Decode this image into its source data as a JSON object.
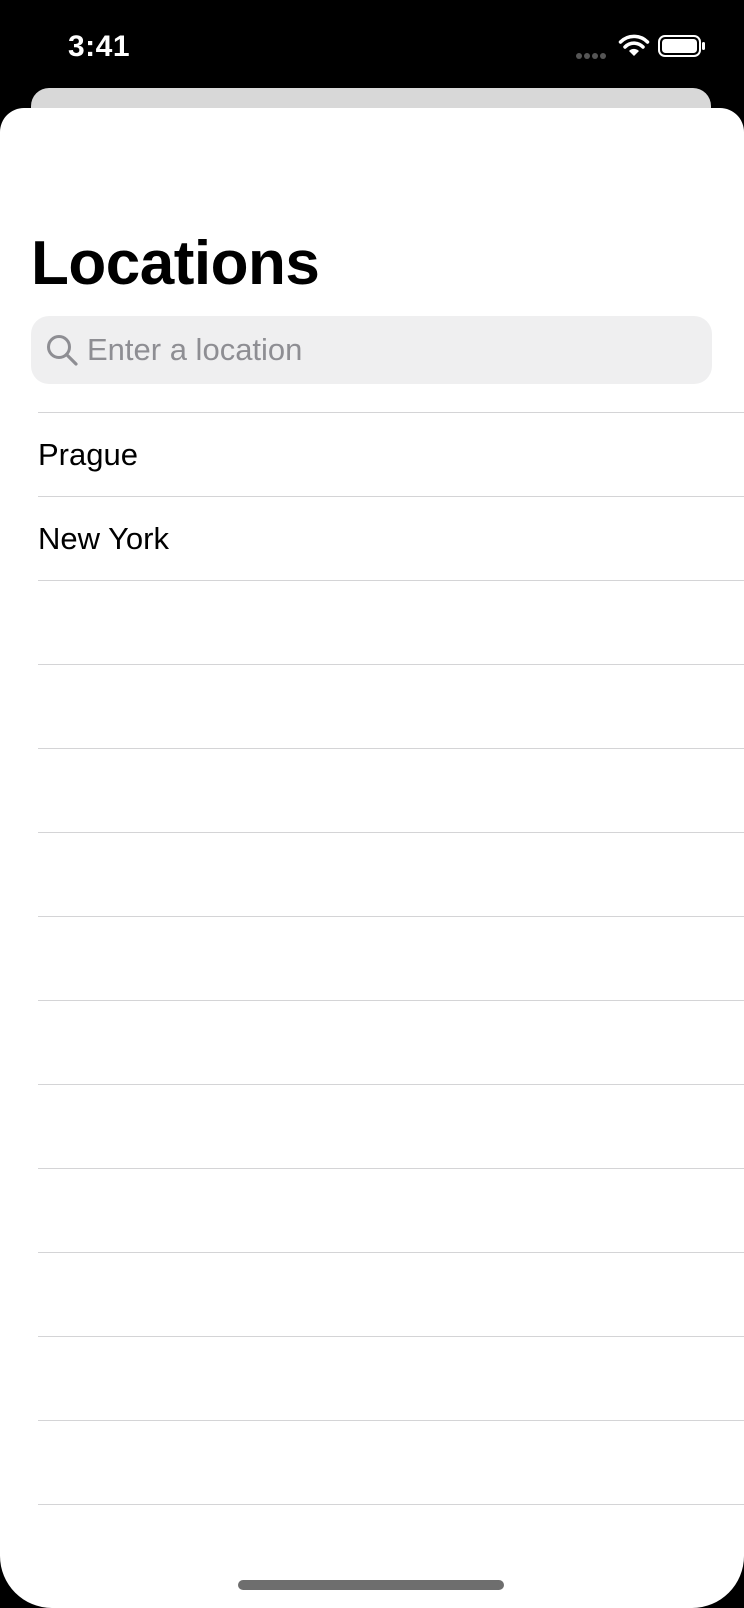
{
  "status_bar": {
    "time": "3:41",
    "icons": [
      "signal-icon",
      "wifi-icon",
      "battery-icon"
    ]
  },
  "header": {
    "title": "Locations"
  },
  "search": {
    "placeholder": "Enter a location",
    "value": "",
    "icon": "search-icon"
  },
  "locations": [
    "Prague",
    "New York",
    "",
    "",
    "",
    "",
    "",
    "",
    "",
    "",
    "",
    "",
    "",
    ""
  ],
  "colors": {
    "background": "#000000",
    "sheet": "#ffffff",
    "search_field": "#efeff0",
    "placeholder": "#8e8e93",
    "separator": "#d4d4d6"
  }
}
